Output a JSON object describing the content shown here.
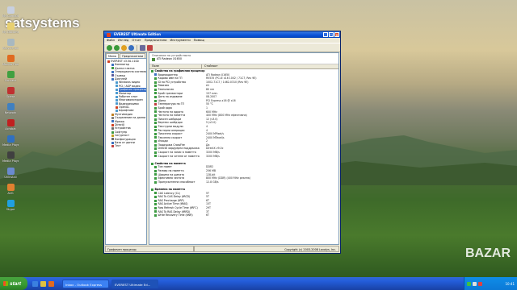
{
  "watermark": {
    "brand": "satsystems",
    "marketplace": "BAZAR"
  },
  "colors": {
    "xp_blue": "#0a52d8",
    "start_green": "#379a30",
    "selection": "#316ac5"
  },
  "desktop_icons": [
    {
      "label": "My Computer",
      "color": "#c8d0e0"
    },
    {
      "label": "My Documents",
      "color": "#e8d070"
    },
    {
      "label": "Recycle Bin",
      "color": "#a8b8c0"
    },
    {
      "label": "Mozilla Firefox",
      "color": "#e06a20"
    },
    {
      "label": "Connect",
      "color": "#40a040"
    },
    {
      "label": "Opera",
      "color": "#c03030"
    },
    {
      "label": "Network",
      "color": "#4080c0"
    },
    {
      "label": "Acrobat",
      "color": "#c02020"
    },
    {
      "label": "Media Player",
      "color": "#3070c0"
    },
    {
      "label": "Media Player Classic",
      "color": "#404040"
    },
    {
      "label": "Uninstall",
      "color": "#6a8ad0"
    },
    {
      "label": "AVG",
      "color": "#e08030"
    },
    {
      "label": "Skype",
      "color": "#20a0e0"
    }
  ],
  "window": {
    "title": "EVEREST Ultimate Edition",
    "menu": [
      "Файл",
      "Изглед",
      "Отчет",
      "Предпочитани",
      "Инструменти",
      "Помощ"
    ],
    "tabs": [
      "Меню",
      "Предпочитани"
    ],
    "tree": [
      {
        "label": "EVEREST v3.50.1100",
        "level": 0,
        "color": "#d04020"
      },
      {
        "label": "Компютър",
        "level": 1,
        "color": "#3a70c0"
      },
      {
        "label": "Дънна платка",
        "level": 1,
        "color": "#3a9a40"
      },
      {
        "label": "Операционна система",
        "level": 1,
        "color": "#3a70c0"
      },
      {
        "label": "Сървър",
        "level": 1,
        "color": "#5a5a9a"
      },
      {
        "label": "Дисплей",
        "level": 1,
        "color": "#3a70c0"
      },
      {
        "label": "Windows видео",
        "level": 2,
        "color": "#4a9ad0"
      },
      {
        "label": "PCI / AGP видео",
        "level": 2,
        "color": "#4a9ad0"
      },
      {
        "label": "Графичен процесор",
        "level": 2,
        "color": "#4a9ad0",
        "selected": true
      },
      {
        "label": "Монитор",
        "level": 2,
        "color": "#4a9ad0"
      },
      {
        "label": "Работен плот",
        "level": 2,
        "color": "#4a9ad0"
      },
      {
        "label": "Многомониторен",
        "level": 2,
        "color": "#4a9ad0"
      },
      {
        "label": "Видеорежими",
        "level": 2,
        "color": "#4a9ad0"
      },
      {
        "label": "OpenGL",
        "level": 2,
        "color": "#d04020"
      },
      {
        "label": "Шрифтове",
        "level": 2,
        "color": "#4a9ad0"
      },
      {
        "label": "Мултимедия",
        "level": 1,
        "color": "#c08020"
      },
      {
        "label": "Съхранение на данни",
        "level": 1,
        "color": "#808080"
      },
      {
        "label": "Мрежа",
        "level": 1,
        "color": "#3a70c0"
      },
      {
        "label": "DirectX",
        "level": 1,
        "color": "#d04020"
      },
      {
        "label": "Устройства",
        "level": 1,
        "color": "#6a6a6a"
      },
      {
        "label": "Софтуер",
        "level": 1,
        "color": "#3a9a40"
      },
      {
        "label": "Сигурност",
        "level": 1,
        "color": "#c0a020"
      },
      {
        "label": "Конфигурация",
        "level": 1,
        "color": "#6a6a6a"
      },
      {
        "label": "База от данни",
        "level": 1,
        "color": "#3a70c0"
      },
      {
        "label": "Тест",
        "level": 1,
        "color": "#c04040"
      }
    ],
    "header": {
      "section": "Описание на устройството",
      "device": "ATI Radeon X1650"
    },
    "columns": {
      "field": "Поле",
      "value": "Стойност"
    },
    "rows": [
      {
        "field": "Свойства на графичния процесор",
        "value": "",
        "group": true,
        "color": "#3a9a40"
      },
      {
        "field": "Видеоадаптер",
        "value": "ATI Radeon X1650",
        "color": "#3a70c0"
      },
      {
        "field": "Кодово име на ГП",
        "value": "RV535 (PCI-E x16 1002 / 71C7, Rev 9E)",
        "color": "#3a9a40"
      },
      {
        "field": "ID на PCI устройство",
        "value": "1002-71C7 / 1462-0310 (Rev 9E)",
        "color": "#3a9a40"
      },
      {
        "field": "Ревизия",
        "value": "A1",
        "color": "#3a9a40"
      },
      {
        "field": "Технология",
        "value": "80 nm",
        "color": "#3a9a40"
      },
      {
        "field": "Брой транзистори",
        "value": "157 млн.",
        "color": "#3a9a40"
      },
      {
        "field": "Дата на издаване",
        "value": "08.2007",
        "color": "#3a9a40"
      },
      {
        "field": "Шина",
        "value": "PCI Express x16 @ x16",
        "color": "#3a9a40"
      },
      {
        "field": "Температура на ГП",
        "value": "55 °C",
        "color": "#c04040"
      },
      {
        "field": "Брой ядра",
        "value": "1",
        "color": "#3a9a40"
      },
      {
        "field": "Честота на ядрото",
        "value": "600 MHz",
        "color": "#3a9a40"
      },
      {
        "field": "Честота на паметта",
        "value": "400 MHz (800 MHz ефективна)",
        "color": "#3a9a40"
      },
      {
        "field": "Пиксел шейдъри",
        "value": "12 (v3.0)",
        "color": "#3a9a40"
      },
      {
        "field": "Вертекс шейдъри",
        "value": "5 (v3.0)",
        "color": "#3a9a40"
      },
      {
        "field": "Текстурни модули",
        "value": "4",
        "color": "#3a9a40"
      },
      {
        "field": "Растерни операции",
        "value": "4",
        "color": "#3a9a40"
      },
      {
        "field": "Пикселна скорост",
        "value": "2400 MPixel/s",
        "color": "#3a9a40"
      },
      {
        "field": "Текселна скорост",
        "value": "2400 MTexel/s",
        "color": "#3a9a40"
      },
      {
        "field": "Изходи",
        "value": "2",
        "color": "#3a9a40"
      },
      {
        "field": "Поддържа CrossFire",
        "value": "Да",
        "color": "#3a9a40"
      },
      {
        "field": "DirectX хардуерна поддръжка",
        "value": "DirectX v9.0c",
        "color": "#3a9a40"
      },
      {
        "field": "Скорост на запис в паметта",
        "value": "3200 MB/s",
        "color": "#3a9a40"
      },
      {
        "field": "Скорост на четене от паметта",
        "value": "3200 MB/s",
        "color": "#3a9a40"
      },
      {
        "field": "",
        "value": "",
        "spacer": true
      },
      {
        "field": "Свойства на паметта",
        "value": "",
        "group": true,
        "color": "#3a9a40"
      },
      {
        "field": "Тип памет",
        "value": "DDR2",
        "color": "#3a9a40"
      },
      {
        "field": "Размер на паметта",
        "value": "256 MB",
        "color": "#3a9a40"
      },
      {
        "field": "Ширина на шината",
        "value": "128-bit",
        "color": "#3a9a40"
      },
      {
        "field": "Ефективна честота",
        "value": "800 MHz (DDR) (400 MHz реална)",
        "color": "#3a9a40"
      },
      {
        "field": "Пропускателна способност",
        "value": "12.8 GB/s",
        "color": "#3a9a40"
      },
      {
        "field": "",
        "value": "",
        "spacer": true
      },
      {
        "field": "Времена на паметта",
        "value": "",
        "group": true,
        "color": "#3a9a40"
      },
      {
        "field": "CAS Latency (CL)",
        "value": "5T",
        "color": "#3a9a40"
      },
      {
        "field": "RAS To CAS Delay (tRCD)",
        "value": "5T",
        "color": "#3a9a40"
      },
      {
        "field": "RAS Precharge (tRP)",
        "value": "6T",
        "color": "#3a9a40"
      },
      {
        "field": "RAS Active Time (tRAS)",
        "value": "15T",
        "color": "#3a9a40"
      },
      {
        "field": "Row Refresh Cycle Time (tRFC)",
        "value": "29T",
        "color": "#3a9a40"
      },
      {
        "field": "RAS To RAS Delay (tRRD)",
        "value": "3T",
        "color": "#3a9a40"
      },
      {
        "field": "Write Recovery Time (tWR)",
        "value": "6T",
        "color": "#3a9a40"
      }
    ],
    "status": {
      "left": "Графичен процесор",
      "right": "Copyright (c) 2003-2008 Lavalys, Inc."
    }
  },
  "taskbar": {
    "start_label": "start",
    "tasks": [
      {
        "label": "Inbox - Outlook Express",
        "active": false
      },
      {
        "label": "EVEREST Ultimate Ed...",
        "active": true
      }
    ],
    "clock": "10:41"
  }
}
